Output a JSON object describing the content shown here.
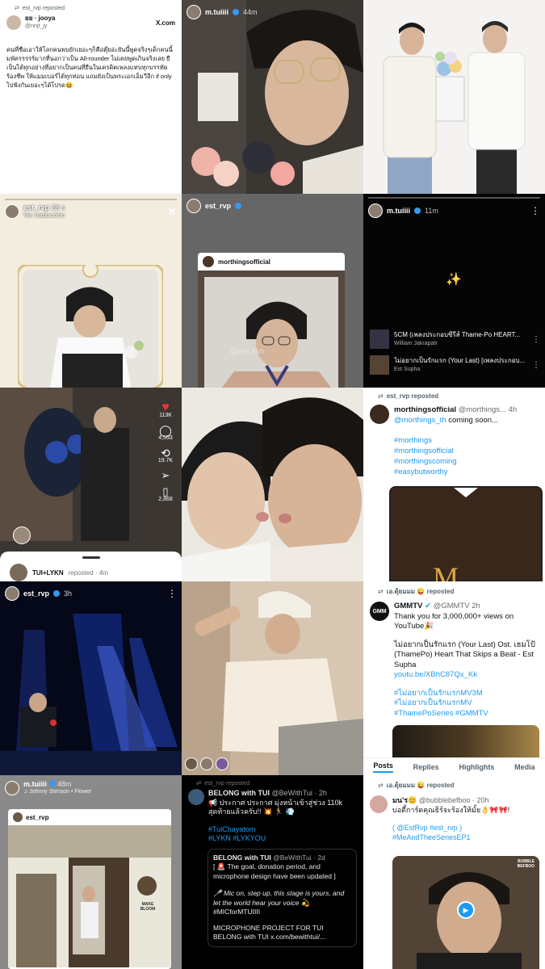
{
  "c1": {
    "repost": "est_rvp reposted",
    "name": "ยย · jooya",
    "handle": "@nnjt_jy",
    "xmark": "X.com",
    "body": "คนที่ชื่อเอาให้โลกคนพบยักเยอะๆก็คือตุ๊ยอ่ะยันนี้พูดจริงๆเด็กคนนี้มพัครรรรร์มากที่นอกว่าเป็น All-rounder ไม่เคยพูดเกินจริงเลย ยืเป็นได้ทุกอย่างที่อยากเป็นคนที่ยืนในเครดิตเพลงแทบทุกบรรทัด ร้องชีพ ให้แมมเบอร์ได้ทุกท่อน แถมยังเป็นพระเอกเอ็มวีอีก if only ไปฟังกันเยอะๆได้โปรด😆"
  },
  "c2": {
    "user": "m.tuiiii",
    "time": "44m"
  },
  "c4": {
    "user": "est_rvp",
    "time": "28 s",
    "translate": "Ver traducción"
  },
  "c5": {
    "user": "est_rvp",
    "inner_user": "morthingsofficial",
    "watermark": "@est.ssn"
  },
  "c6": {
    "user": "m.tuiiii",
    "time": "11m",
    "sparkle": "✨",
    "songs": [
      {
        "title": "5CM (เพลงประกอบซีรีส์ Thame-Po HEART...",
        "artist": "William Jakrapatr"
      },
      {
        "title": "ไม่อยากเป็นรักแรก (Your Last) [เพลงประกอบ...",
        "artist": "Est Supha"
      }
    ]
  },
  "c7": {
    "likes": "113K",
    "comments": "4,553",
    "shares": "19.7K",
    "saves": "2,868",
    "sheet_user": "TUI+LYKN",
    "sheet_meta": "reposted · 4m"
  },
  "c9": {
    "repost": "est_rvp reposted",
    "name": "morthingsofficial",
    "handle": "@morthings...",
    "time": "4h",
    "line1": "@morthings_th",
    "line1b": " coming soon...",
    "tags": [
      "#morthings",
      "#morthingsofficial",
      "#morthingscoming",
      "#easybutworthy"
    ]
  },
  "c10": {
    "user": "est_rvp",
    "time": "3h"
  },
  "c12": {
    "repost": "เอ.ตุ้ยมมม 😜 reposted",
    "name": "GMMTV",
    "handle": "@GMMTV",
    "time": "2h",
    "avatar_text": "GMM",
    "line1": "Thank you for 3,000,000+ views on YouTube🎉",
    "line2": "ไม่อยากเป็นรักแรก (Your Last) Ost. เธมโป้ (ThamePo) Heart That Skips a Beat - Est Supha",
    "link": "youtu.be/XBhC87Qx_Kk",
    "tags": [
      "#ไม่อยากเป็นรักแรกMV3M",
      "#ไม่อยากเป็นรักแรกMV",
      "#ThamePoSeries #GMMTV"
    ],
    "tabs": [
      "Posts",
      "Replies",
      "Highlights",
      "Media"
    ]
  },
  "c13": {
    "user": "m.tuiiii",
    "time": "48m",
    "music": "♫ Johnny Stimson • Flower",
    "inner_user": "est_rvp",
    "sign_text": "MAKE BLOOM"
  },
  "c14": {
    "repost": "est_rvp reposted",
    "name": "BELONG with TUI",
    "handle": "@BeWithTui · 2h",
    "body": "📢 ประกาศ ประกาศ มุ่งหน้าเข้าสู่ช่วง 110k สุดท้ายแล้วครับ!! 💥 🏃 💨",
    "tags": "#TuiChayatorn\n#LYKN #LYKYOU",
    "q_name": "BELONG with TUI",
    "q_handle": "@BeWithTui · 2d",
    "q_body": "[ 🚨 The goal, donation period, and microphone design have been updated ]",
    "q_quote": "🎤 Mic on, step up, this stage is yours, and let the world hear your voice 💫",
    "q_tag": "#MICforMTUIIII",
    "q_project": "MICROPHONE PROJECT FOR TUI",
    "q_link": "BELONG with TUI x.com/bewithtui/..."
  },
  "c15": {
    "repost": "เอ.ตุ้ยมมม 😜 reposted",
    "name": "มน'ร😊",
    "handle": "@bubblebefboo · 20h",
    "body": "บอดี้การ์ดคุณธิร์จะร้องให้มั้ย👌🎀🎀!",
    "line2": "( @EstRvp #est_rvp )",
    "tag": "#MeAndTheeSeriesEP1",
    "badge": "BUBBLE BEFBOO"
  }
}
